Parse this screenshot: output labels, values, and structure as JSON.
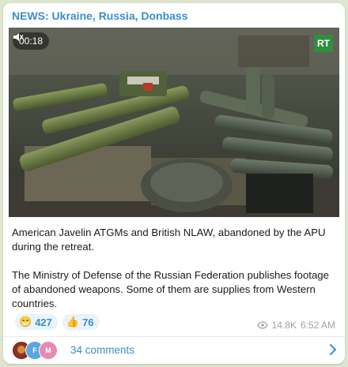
{
  "post": {
    "channel": "NEWS: Ukraine, Russia, Donbass",
    "video": {
      "timer": "00:18",
      "muted_icon": "speaker-muted-icon",
      "watermark": "RT"
    },
    "caption_line1": "American Javelin ATGMs and British NLAW, abandoned by the APU during the retreat.",
    "caption_line2": "The Ministry of Defense of the Russian Federation publishes footage of abandoned weapons. Some of them are supplies from Western countries.",
    "reactions": [
      {
        "emoji": "😁",
        "count": "427"
      },
      {
        "emoji": "👍",
        "count": "76"
      }
    ],
    "views": "14.8K",
    "time": "6:52 AM",
    "comments": {
      "label": "34 comments",
      "avatars": [
        "F",
        "M"
      ]
    }
  },
  "colors": {
    "accent": "#3a8fc7",
    "background": "#dfe6cf",
    "rt_green": "#2f8f3f"
  }
}
